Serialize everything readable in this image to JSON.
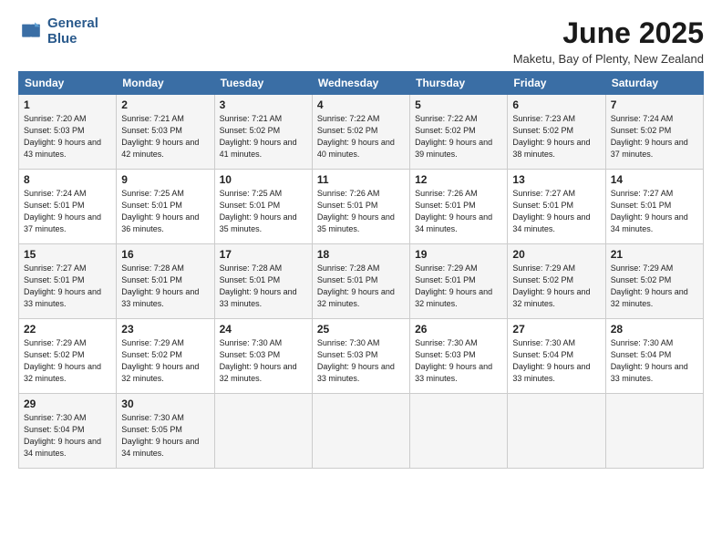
{
  "header": {
    "logo_line1": "General",
    "logo_line2": "Blue",
    "month": "June 2025",
    "location": "Maketu, Bay of Plenty, New Zealand"
  },
  "weekdays": [
    "Sunday",
    "Monday",
    "Tuesday",
    "Wednesday",
    "Thursday",
    "Friday",
    "Saturday"
  ],
  "weeks": [
    [
      {
        "day": "1",
        "rise": "7:20 AM",
        "set": "5:03 PM",
        "daylight": "9 hours and 43 minutes."
      },
      {
        "day": "2",
        "rise": "7:21 AM",
        "set": "5:03 PM",
        "daylight": "9 hours and 42 minutes."
      },
      {
        "day": "3",
        "rise": "7:21 AM",
        "set": "5:02 PM",
        "daylight": "9 hours and 41 minutes."
      },
      {
        "day": "4",
        "rise": "7:22 AM",
        "set": "5:02 PM",
        "daylight": "9 hours and 40 minutes."
      },
      {
        "day": "5",
        "rise": "7:22 AM",
        "set": "5:02 PM",
        "daylight": "9 hours and 39 minutes."
      },
      {
        "day": "6",
        "rise": "7:23 AM",
        "set": "5:02 PM",
        "daylight": "9 hours and 38 minutes."
      },
      {
        "day": "7",
        "rise": "7:24 AM",
        "set": "5:02 PM",
        "daylight": "9 hours and 37 minutes."
      }
    ],
    [
      {
        "day": "8",
        "rise": "7:24 AM",
        "set": "5:01 PM",
        "daylight": "9 hours and 37 minutes."
      },
      {
        "day": "9",
        "rise": "7:25 AM",
        "set": "5:01 PM",
        "daylight": "9 hours and 36 minutes."
      },
      {
        "day": "10",
        "rise": "7:25 AM",
        "set": "5:01 PM",
        "daylight": "9 hours and 35 minutes."
      },
      {
        "day": "11",
        "rise": "7:26 AM",
        "set": "5:01 PM",
        "daylight": "9 hours and 35 minutes."
      },
      {
        "day": "12",
        "rise": "7:26 AM",
        "set": "5:01 PM",
        "daylight": "9 hours and 34 minutes."
      },
      {
        "day": "13",
        "rise": "7:27 AM",
        "set": "5:01 PM",
        "daylight": "9 hours and 34 minutes."
      },
      {
        "day": "14",
        "rise": "7:27 AM",
        "set": "5:01 PM",
        "daylight": "9 hours and 34 minutes."
      }
    ],
    [
      {
        "day": "15",
        "rise": "7:27 AM",
        "set": "5:01 PM",
        "daylight": "9 hours and 33 minutes."
      },
      {
        "day": "16",
        "rise": "7:28 AM",
        "set": "5:01 PM",
        "daylight": "9 hours and 33 minutes."
      },
      {
        "day": "17",
        "rise": "7:28 AM",
        "set": "5:01 PM",
        "daylight": "9 hours and 33 minutes."
      },
      {
        "day": "18",
        "rise": "7:28 AM",
        "set": "5:01 PM",
        "daylight": "9 hours and 32 minutes."
      },
      {
        "day": "19",
        "rise": "7:29 AM",
        "set": "5:01 PM",
        "daylight": "9 hours and 32 minutes."
      },
      {
        "day": "20",
        "rise": "7:29 AM",
        "set": "5:02 PM",
        "daylight": "9 hours and 32 minutes."
      },
      {
        "day": "21",
        "rise": "7:29 AM",
        "set": "5:02 PM",
        "daylight": "9 hours and 32 minutes."
      }
    ],
    [
      {
        "day": "22",
        "rise": "7:29 AM",
        "set": "5:02 PM",
        "daylight": "9 hours and 32 minutes."
      },
      {
        "day": "23",
        "rise": "7:29 AM",
        "set": "5:02 PM",
        "daylight": "9 hours and 32 minutes."
      },
      {
        "day": "24",
        "rise": "7:30 AM",
        "set": "5:03 PM",
        "daylight": "9 hours and 32 minutes."
      },
      {
        "day": "25",
        "rise": "7:30 AM",
        "set": "5:03 PM",
        "daylight": "9 hours and 33 minutes."
      },
      {
        "day": "26",
        "rise": "7:30 AM",
        "set": "5:03 PM",
        "daylight": "9 hours and 33 minutes."
      },
      {
        "day": "27",
        "rise": "7:30 AM",
        "set": "5:04 PM",
        "daylight": "9 hours and 33 minutes."
      },
      {
        "day": "28",
        "rise": "7:30 AM",
        "set": "5:04 PM",
        "daylight": "9 hours and 33 minutes."
      }
    ],
    [
      {
        "day": "29",
        "rise": "7:30 AM",
        "set": "5:04 PM",
        "daylight": "9 hours and 34 minutes."
      },
      {
        "day": "30",
        "rise": "7:30 AM",
        "set": "5:05 PM",
        "daylight": "9 hours and 34 minutes."
      },
      null,
      null,
      null,
      null,
      null
    ]
  ]
}
